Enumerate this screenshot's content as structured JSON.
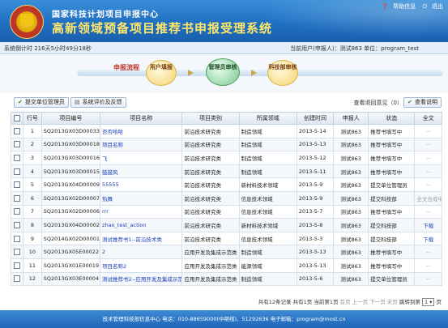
{
  "header": {
    "org": "国家科技计划项目申报中心",
    "system_title": "高新领域预备项目推荐书申报受理系统",
    "help_link": "帮助信息",
    "logout_link": "退出"
  },
  "statusbar": {
    "timer": "系统倒计时 216天5小时49分18秒",
    "current_user": "当前用户(申报人)：测试863 单位：program_test"
  },
  "flow": {
    "label": "申报流程",
    "steps": [
      "用户填报",
      "管理员审核",
      "科技部审核"
    ]
  },
  "toolbar": {
    "submit_btn": "提交单位管理员",
    "eval_btn": "系统评价及反馈",
    "opinion": "查看退回意见（0）",
    "help_btn": "查看说明"
  },
  "table": {
    "headers": [
      "",
      "行号",
      "项目编号",
      "项目名称",
      "项目类别",
      "所属领域",
      "创建时间",
      "申报人",
      "状态",
      "全文"
    ],
    "rows": [
      [
        "1",
        "SQ2013GX03D00033",
        "否否哈哈",
        "前沿技术研究类",
        "制造领域",
        "2013-5-14",
        "测试863",
        "推荐书填写中",
        "--"
      ],
      [
        "2",
        "SQ2013GX03D00018",
        "项目名称",
        "前沿技术研究类",
        "制造领域",
        "2013-5-13",
        "测试863",
        "推荐书填写中",
        "--"
      ],
      [
        "3",
        "SQ2013GX03D00016",
        "飞",
        "前沿技术研究类",
        "制造领域",
        "2013-5-12",
        "测试863",
        "推荐书填写中",
        "--"
      ],
      [
        "4",
        "SQ2013GX03D00015",
        "鼓鼓风",
        "前沿技术研究类",
        "制造领域",
        "2013-5-11",
        "测试863",
        "推荐书填写中",
        "--"
      ],
      [
        "5",
        "SQ2013GX04D00009",
        "55555",
        "前沿技术研究类",
        "新材料技术领域",
        "2013-5-9",
        "测试863",
        "提交单位管理员",
        "--"
      ],
      [
        "6",
        "SQ2013GX02D00007",
        "热舞",
        "前沿技术研究类",
        "信息技术领域",
        "2013-5-9",
        "测试863",
        "提交科技部",
        "全文合成中"
      ],
      [
        "7",
        "SQ2013GX02D00006",
        "rrr",
        "前沿技术研究类",
        "信息技术领域",
        "2013-5-7",
        "测试863",
        "推荐书填写中",
        "--"
      ],
      [
        "8",
        "SQ2013GX04D00002",
        "zhao_test_action",
        "前沿技术研究类",
        "新材料技术领域",
        "2013-5-8",
        "测试863",
        "提交科技部",
        "下载"
      ],
      [
        "9",
        "SQ2014GX02D00001",
        "测试推荐书1--前沿技术类",
        "前沿技术研究类",
        "信息技术领域",
        "2013-5-3",
        "测试863",
        "提交科技部",
        "下载"
      ],
      [
        "10",
        "SQ2013GX05E00022",
        "2",
        "应用开发及集成示范类",
        "制造领域",
        "2013-5-13",
        "测试863",
        "推荐书填写中",
        "--"
      ],
      [
        "11",
        "SQ2013GX01E00019",
        "项目名称2",
        "应用开发及集成示范类",
        "能源领域",
        "2013-5-13",
        "测试863",
        "推荐书填写中",
        "--"
      ],
      [
        "12",
        "SQ2013GX03E00004",
        "测试推荐书2--应用开发及集成示范类",
        "应用开发及集成示范类",
        "制造领域",
        "2013-5-6",
        "测试863",
        "提交单位管理员",
        "--"
      ]
    ]
  },
  "pager": {
    "summary": "共有12条记录 共有1页 当前第1页",
    "first": "首页",
    "prev": "上一页",
    "next": "下一页",
    "last": "末页",
    "jump": "跳转到第",
    "page": "1",
    "page_suffix": "页"
  },
  "footer": {
    "text": "技术管理科技部信息中心  电话：010-88659000(中继线)、51292636  电子邮箱：program@most.cn"
  }
}
